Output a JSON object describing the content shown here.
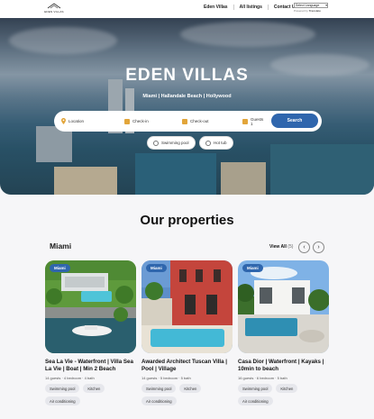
{
  "header": {
    "logo_text": "EDEN VILLAS",
    "nav": [
      "Eden Villas",
      "All listings",
      "Contact Us"
    ],
    "language_select": "Select Language",
    "powered_by": "Powered by",
    "translate_brand": "Translate"
  },
  "hero": {
    "title": "EDEN VILLAS",
    "subtitle": "Miami | Hallandale Beach | Hollywood",
    "search": {
      "location": "Location",
      "checkin": "Check-in",
      "checkout": "Check-out",
      "guests_label": "Guests",
      "guests_value": "1",
      "button": "Search"
    },
    "filters": [
      "Swimming pool",
      "Hot tub"
    ]
  },
  "properties": {
    "title": "Our properties",
    "city": "Miami",
    "view_all": "View All",
    "view_all_count": "(5)",
    "cards": [
      {
        "badge": "Miami",
        "title": "Sea La Vie - Waterfront | Villa Sea La Vie | Boat | Min 2 Beach",
        "info": "14 guests · 4 bedroom · 4 bath",
        "tags": [
          "Swimming pool",
          "Kitchen",
          "Air conditioning"
        ]
      },
      {
        "badge": "Miami",
        "title": "Awarded Architect Tuscan Villa | Pool | Village",
        "info": "14 guests · 5 bedroom · 5 bath",
        "tags": [
          "Swimming pool",
          "Kitchen",
          "Air conditioning"
        ]
      },
      {
        "badge": "Miami",
        "title": "Casa Dior | Waterfront | Kayaks | 10min to beach",
        "info": "16 guests · 6 bedroom · 5 bath",
        "tags": [
          "Swimming pool",
          "Kitchen",
          "Air conditioning"
        ]
      }
    ]
  },
  "colors": {
    "accent": "#2f66ad",
    "search_icon": "#e2a53a",
    "tag_bg": "#e6e7ec"
  }
}
